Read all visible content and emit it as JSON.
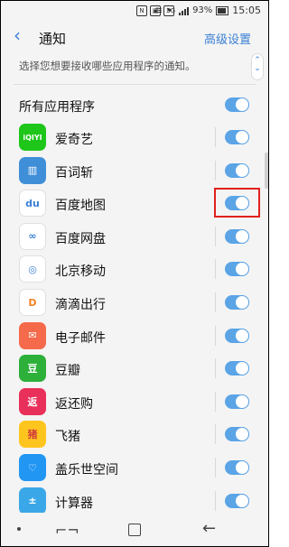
{
  "status": {
    "battery": "93%",
    "time": "15:05",
    "network": "3G"
  },
  "header": {
    "title": "通知",
    "advanced": "高级设置"
  },
  "description": "选择您想要接收哪些应用程序的通知。",
  "all_apps": {
    "label": "所有应用程序",
    "enabled": true
  },
  "apps": [
    {
      "name": "爱奇艺",
      "icon": "iqiyi-icon",
      "color": "#1ec61a",
      "glyph": "iQIYI",
      "enabled": true
    },
    {
      "name": "百词斩",
      "icon": "baicizhan-icon",
      "color": "#3f8fd8",
      "glyph": "▥",
      "enabled": true
    },
    {
      "name": "百度地图",
      "icon": "baidu-map-icon",
      "color": "#ffffff",
      "glyph": "du",
      "enabled": true
    },
    {
      "name": "百度网盘",
      "icon": "baidu-netdisk-icon",
      "color": "#ffffff",
      "glyph": "∞",
      "enabled": true
    },
    {
      "name": "北京移动",
      "icon": "china-mobile-icon",
      "color": "#ffffff",
      "glyph": "◎",
      "enabled": true
    },
    {
      "name": "滴滴出行",
      "icon": "didi-icon",
      "color": "#ffffff",
      "glyph": "D",
      "enabled": true
    },
    {
      "name": "电子邮件",
      "icon": "email-icon",
      "color": "#f46a4a",
      "glyph": "✉",
      "enabled": true
    },
    {
      "name": "豆瓣",
      "icon": "douban-icon",
      "color": "#2db03a",
      "glyph": "豆",
      "enabled": true
    },
    {
      "name": "返还购",
      "icon": "fanhuangou-icon",
      "color": "#e8305a",
      "glyph": "返",
      "enabled": true
    },
    {
      "name": "飞猪",
      "icon": "fliggy-icon",
      "color": "#ffc51f",
      "glyph": "猪",
      "enabled": true
    },
    {
      "name": "盖乐世空间",
      "icon": "galaxy-space-icon",
      "color": "#2196f3",
      "glyph": "♡",
      "enabled": true
    },
    {
      "name": "计算器",
      "icon": "calculator-icon",
      "color": "#3aa8e8",
      "glyph": "±",
      "enabled": true
    }
  ]
}
